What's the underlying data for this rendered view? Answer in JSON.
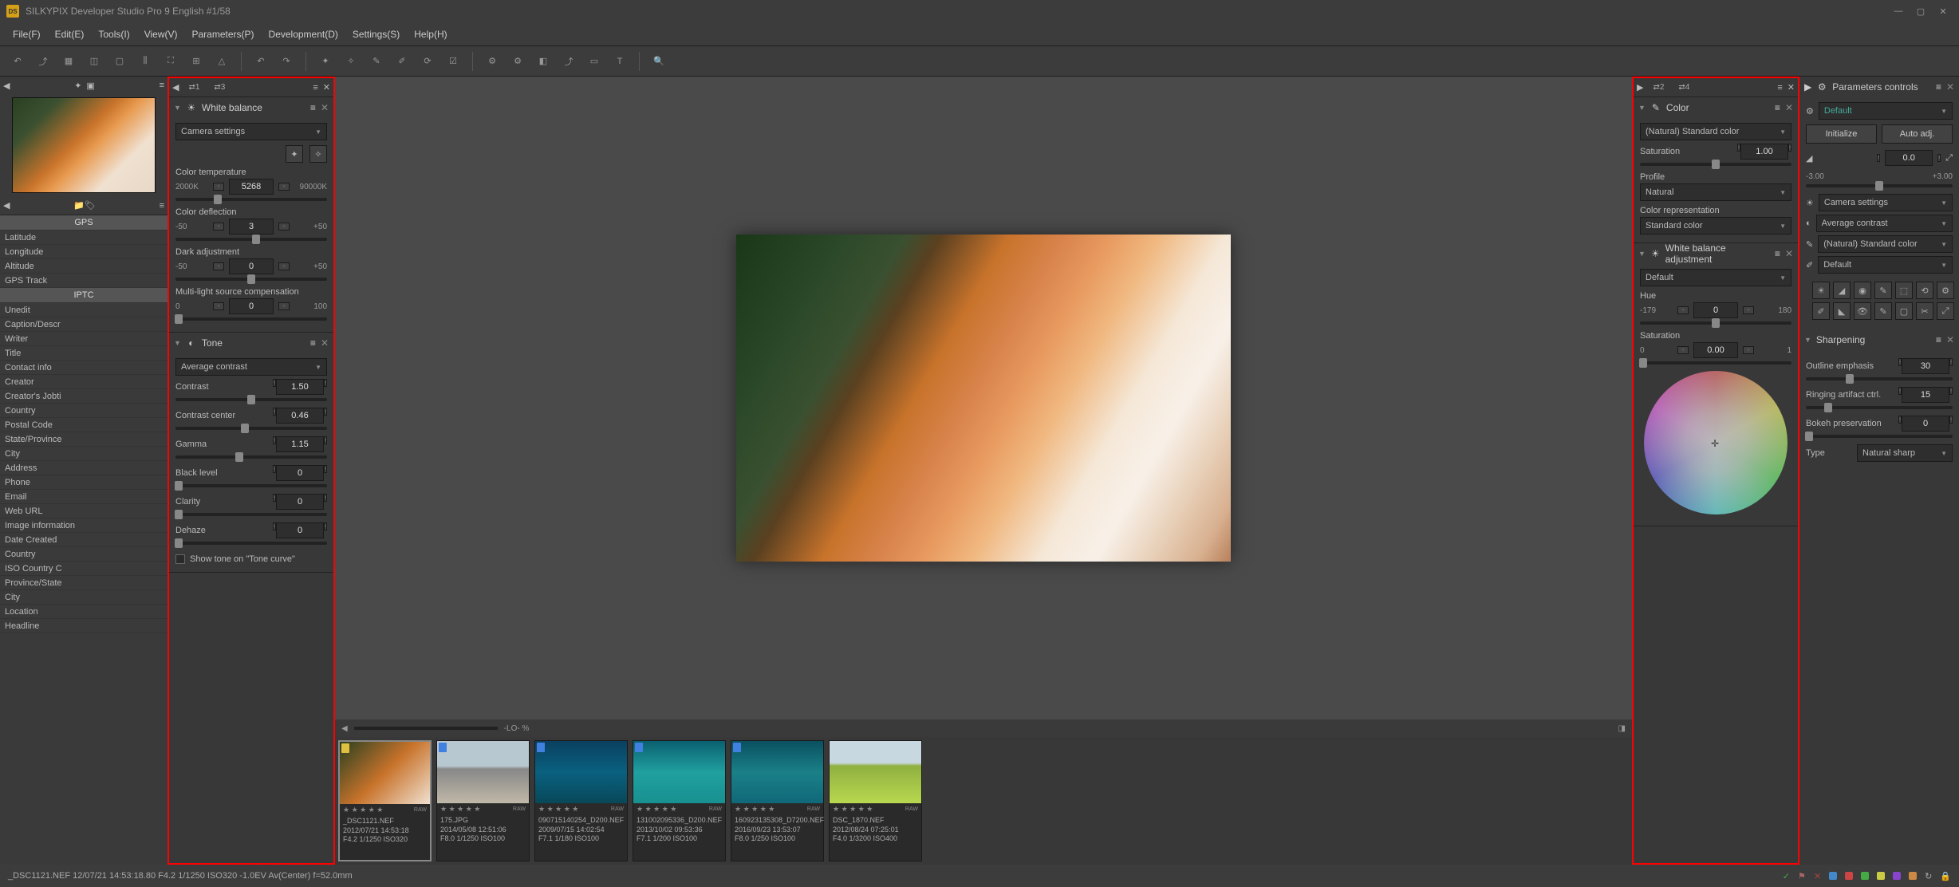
{
  "app": {
    "title": "SILKYPIX Developer Studio Pro 9 English   #1/58"
  },
  "menu": [
    "File(F)",
    "Edit(E)",
    "Tools(I)",
    "View(V)",
    "Parameters(P)",
    "Development(D)",
    "Settings(S)",
    "Help(H)"
  ],
  "gps": {
    "header": "GPS",
    "rows": [
      "Latitude",
      "Longitude",
      "Altitude",
      "GPS Track"
    ]
  },
  "iptc": {
    "header": "IPTC",
    "rows": [
      "Unedit",
      "Caption/Descr",
      "Writer",
      "Title",
      "Contact info",
      "Creator",
      "Creator's Jobti",
      "Country",
      "Postal Code",
      "State/Province",
      "City",
      "Address",
      "Phone",
      "Email",
      "Web URL",
      "Image information",
      "Date Created",
      "Country",
      "ISO Country C",
      "Province/State",
      "City",
      "Location",
      "Headline"
    ]
  },
  "wb": {
    "title": "White balance",
    "preset": "Camera settings",
    "temp": {
      "label": "Color temperature",
      "min": "2000K",
      "val": "5268",
      "max": "90000K",
      "pos": 28
    },
    "deflect": {
      "label": "Color deflection",
      "min": "-50",
      "val": "3",
      "max": "+50",
      "pos": 53
    },
    "dark": {
      "label": "Dark adjustment",
      "min": "-50",
      "val": "0",
      "max": "+50",
      "pos": 50
    },
    "multi": {
      "label": "Multi-light source compensation",
      "min": "0",
      "val": "0",
      "max": "100",
      "pos": 2
    }
  },
  "tone": {
    "title": "Tone",
    "preset": "Average contrast",
    "contrast": {
      "label": "Contrast",
      "val": "1.50",
      "pos": 50
    },
    "center": {
      "label": "Contrast center",
      "val": "0.46",
      "pos": 46
    },
    "gamma": {
      "label": "Gamma",
      "val": "1.15",
      "pos": 42
    },
    "black": {
      "label": "Black level",
      "val": "0",
      "pos": 2
    },
    "clarity": {
      "label": "Clarity",
      "val": "0",
      "pos": 2
    },
    "dehaze": {
      "label": "Dehaze",
      "val": "0",
      "pos": 2
    },
    "show_tone": "Show tone on \"Tone curve\""
  },
  "color": {
    "title": "Color",
    "preset": "(Natural) Standard color",
    "sat": {
      "label": "Saturation",
      "val": "1.00",
      "pos": 50
    },
    "profile": {
      "label": "Profile",
      "val": "Natural"
    },
    "rep": {
      "label": "Color representation",
      "val": "Standard color"
    }
  },
  "wba": {
    "title": "White balance adjustment",
    "preset": "Default",
    "hue": {
      "label": "Hue",
      "min": "-179",
      "val": "0",
      "max": "180",
      "pos": 50
    },
    "sat": {
      "label": "Saturation",
      "min": "0",
      "val": "0.00",
      "max": "1",
      "pos": 2
    }
  },
  "params": {
    "title": "Parameters controls",
    "default_preset": "Default",
    "init": "Initialize",
    "auto": "Auto adj.",
    "exposure": {
      "val": "0.0",
      "min": "-3.00",
      "max": "+3.00",
      "pos": 50
    },
    "dropdowns": [
      "Camera settings",
      "Average contrast",
      "(Natural) Standard color",
      "Default"
    ]
  },
  "sharp": {
    "title": "Sharpening",
    "outline": {
      "label": "Outline emphasis",
      "val": "30",
      "pos": 30
    },
    "ringing": {
      "label": "Ringing artifact ctrl.",
      "val": "15",
      "pos": 15
    },
    "bokeh": {
      "label": "Bokeh preservation",
      "val": "0",
      "pos": 2
    },
    "type": {
      "label": "Type",
      "val": "Natural sharp"
    }
  },
  "viewer": {
    "zoom": "-LO-  %"
  },
  "thumbs": [
    {
      "name": "_DSC1121.NEF",
      "date": "2012/07/21 14:53:18",
      "exif": "F4.2 1/1250 ISO320",
      "cls": "",
      "tag": "yellow"
    },
    {
      "name": "175.JPG",
      "date": "2014/05/08 12:51:06",
      "exif": "F8.0 1/1250 ISO100",
      "cls": "train",
      "tag": "blue"
    },
    {
      "name": "090715140254_D200.NEF",
      "date": "2009/07/15 14:02:54",
      "exif": "F7.1 1/180 ISO100",
      "cls": "water1",
      "tag": "blue"
    },
    {
      "name": "131002095336_D200.NEF",
      "date": "2013/10/02 09:53:36",
      "exif": "F7.1 1/200 ISO100",
      "cls": "water2",
      "tag": "blue"
    },
    {
      "name": "160923135308_D7200.NEF",
      "date": "2016/09/23 13:53:07",
      "exif": "F8.0 1/250 ISO100",
      "cls": "water3",
      "tag": "blue"
    },
    {
      "name": "DSC_1870.NEF",
      "date": "2012/08/24 07:25:01",
      "exif": "F4.0 1/3200 ISO400",
      "cls": "field",
      "tag": ""
    }
  ],
  "status": "_DSC1121.NEF 12/07/21 14:53:18.80 F4.2 1/1250 ISO320 -1.0EV Av(Center) f=52.0mm"
}
